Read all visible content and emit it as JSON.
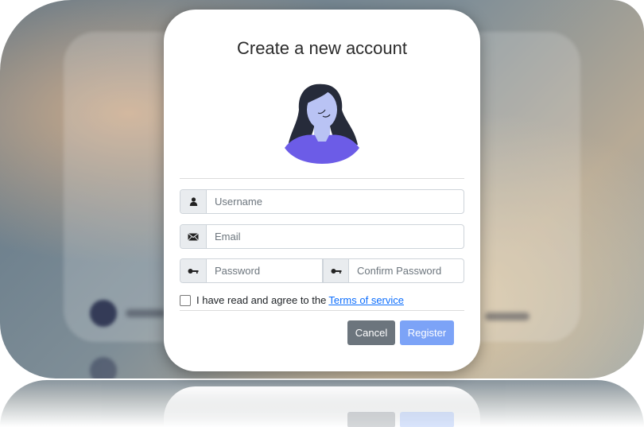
{
  "dialog": {
    "title": "Create a new account",
    "fields": {
      "username_placeholder": "Username",
      "email_placeholder": "Email",
      "password_placeholder": "Password",
      "confirm_password_placeholder": "Confirm Password"
    },
    "terms": {
      "text": "I have read and agree to the",
      "link": "Terms of service",
      "checked": false
    },
    "buttons": {
      "cancel": "Cancel",
      "register": "Register"
    }
  },
  "icons": {
    "username": "user-icon",
    "email": "envelope-icon",
    "password": "key-icon",
    "confirm_password": "key-icon"
  },
  "colors": {
    "cancel_button": "#6c757d",
    "register_button": "#7ca3f7",
    "link": "#0d6efd",
    "avatar_shirt": "#6c5ce7"
  }
}
